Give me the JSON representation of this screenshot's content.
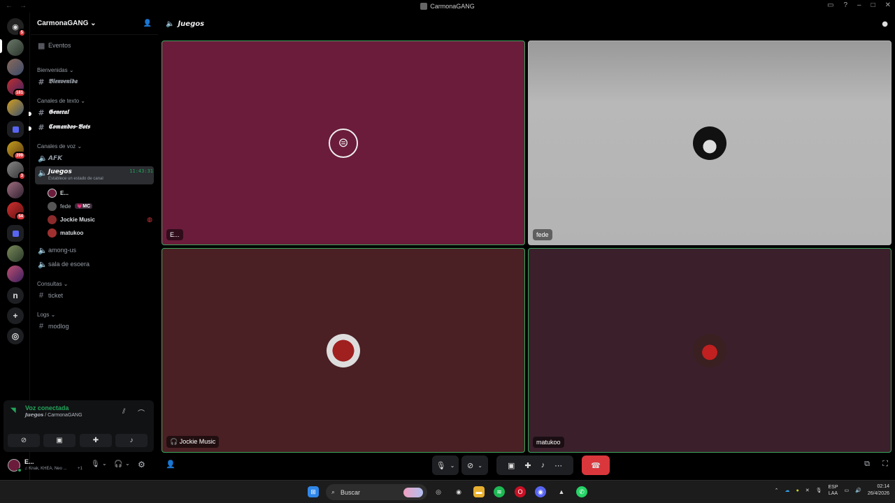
{
  "window": {
    "title": "CarmonaGANG"
  },
  "servers": {
    "badges": [
      "5",
      "181",
      "399",
      "3",
      "54"
    ],
    "letter": "n"
  },
  "guild": {
    "name": "CarmonaGANG"
  },
  "sidebar": {
    "events": "Eventos",
    "cat_welcome": "Bienvenidas",
    "welcome_channel": "𝕭𝖎𝖊𝖓𝖛𝖊𝖓𝖎𝖉𝖆",
    "cat_text": "Canales de texto",
    "general": "𝕲𝖊𝖓𝖊𝖗𝖆𝖑",
    "commands": "𝕮𝖔𝖒𝖆𝖓𝖉𝖔𝖘-𝕭𝖔𝖙𝖘",
    "cat_voice": "Canales de voz",
    "afk": "𝘼𝙁𝙆",
    "juegos": "𝙅𝙪𝙚𝙜𝙤𝙨",
    "juegos_time": "11:43:31",
    "juegos_status": "Establece un estado de canal",
    "members": [
      {
        "name": "E...",
        "tag": ""
      },
      {
        "name": "fede",
        "tag": "💗MC"
      },
      {
        "name": "Jockie Music",
        "tag": ""
      },
      {
        "name": "matukoo",
        "tag": ""
      }
    ],
    "among": "among-us",
    "espera": "sala de esoera",
    "cat_consultas": "Consultas",
    "ticket": "ticket",
    "cat_logs": "Logs",
    "modlog": "modlog"
  },
  "voice": {
    "title": "Voz conectada",
    "subtitle": "𝙅𝙪𝙚𝙜𝙤𝙨 / CarmonaGANG"
  },
  "user": {
    "name": "E...",
    "activity": "♫ Knak, KHEA, Neo ...",
    "extra": "+1"
  },
  "main": {
    "channel": "𝙅𝙪𝙚𝙜𝙤𝙨"
  },
  "tiles": [
    {
      "label": "E...",
      "bg": "#6b1c3b"
    },
    {
      "label": "fede",
      "bg": "#b3b3b3"
    },
    {
      "label": "Jockie Music",
      "bg": "#4a2024"
    },
    {
      "label": "matukoo",
      "bg": "#3b1f2b"
    }
  ],
  "taskbar": {
    "search": "Buscar",
    "lang1": "ESP",
    "lang2": "LAA",
    "time": "02:14",
    "date": "26/4/2026"
  }
}
